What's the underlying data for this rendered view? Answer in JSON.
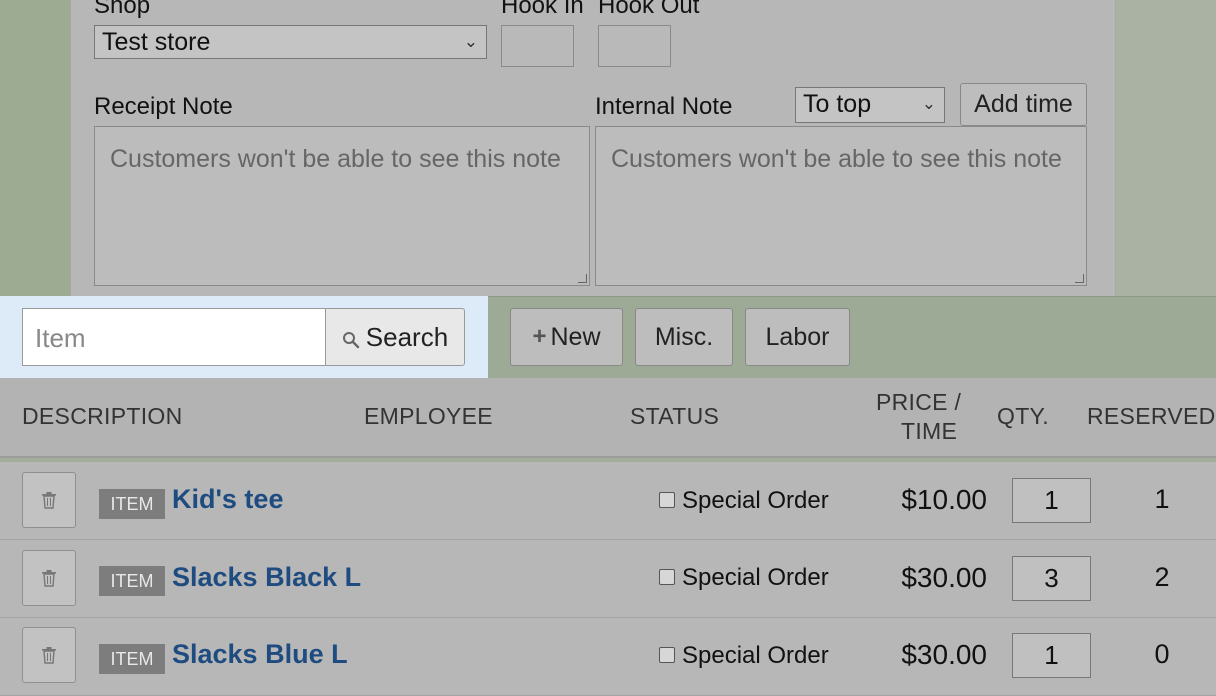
{
  "form": {
    "shop_label": "Shop",
    "shop_value": "Test store",
    "hook_in_label": "Hook In",
    "hook_out_label": "Hook Out",
    "receipt_note_label": "Receipt Note",
    "internal_note_label": "Internal Note",
    "position_select_value": "To top",
    "add_time_label": "Add time",
    "receipt_note_placeholder": "Customers won't be able to see this note",
    "internal_note_placeholder": "Customers won't be able to see this note"
  },
  "toolbar": {
    "item_placeholder": "Item",
    "search_label": "Search",
    "new_label": "New",
    "misc_label": "Misc.",
    "labor_label": "Labor"
  },
  "table": {
    "headers": {
      "description": "DESCRIPTION",
      "employee": "EMPLOYEE",
      "status": "STATUS",
      "price_line1": "PRICE /",
      "price_line2": "TIME",
      "qty": "QTY.",
      "reserved": "RESERVED"
    },
    "rows": [
      {
        "tag": "ITEM",
        "name": "Kid's tee",
        "status": "Special Order",
        "price": "$10.00",
        "qty": "1",
        "reserved": "1"
      },
      {
        "tag": "ITEM",
        "name": "Slacks Black L",
        "status": "Special Order",
        "price": "$30.00",
        "qty": "3",
        "reserved": "2"
      },
      {
        "tag": "ITEM",
        "name": "Slacks Blue L",
        "status": "Special Order",
        "price": "$30.00",
        "qty": "1",
        "reserved": "0"
      }
    ]
  },
  "icons": {
    "search": "magnifier-icon",
    "plus": "plus-icon",
    "trash": "trash-icon",
    "chevron": "chevron-down-icon"
  },
  "colors": {
    "link": "#1f4c80",
    "search_highlight": "#dcebf7",
    "toolbar_bg": "#9daa95"
  }
}
